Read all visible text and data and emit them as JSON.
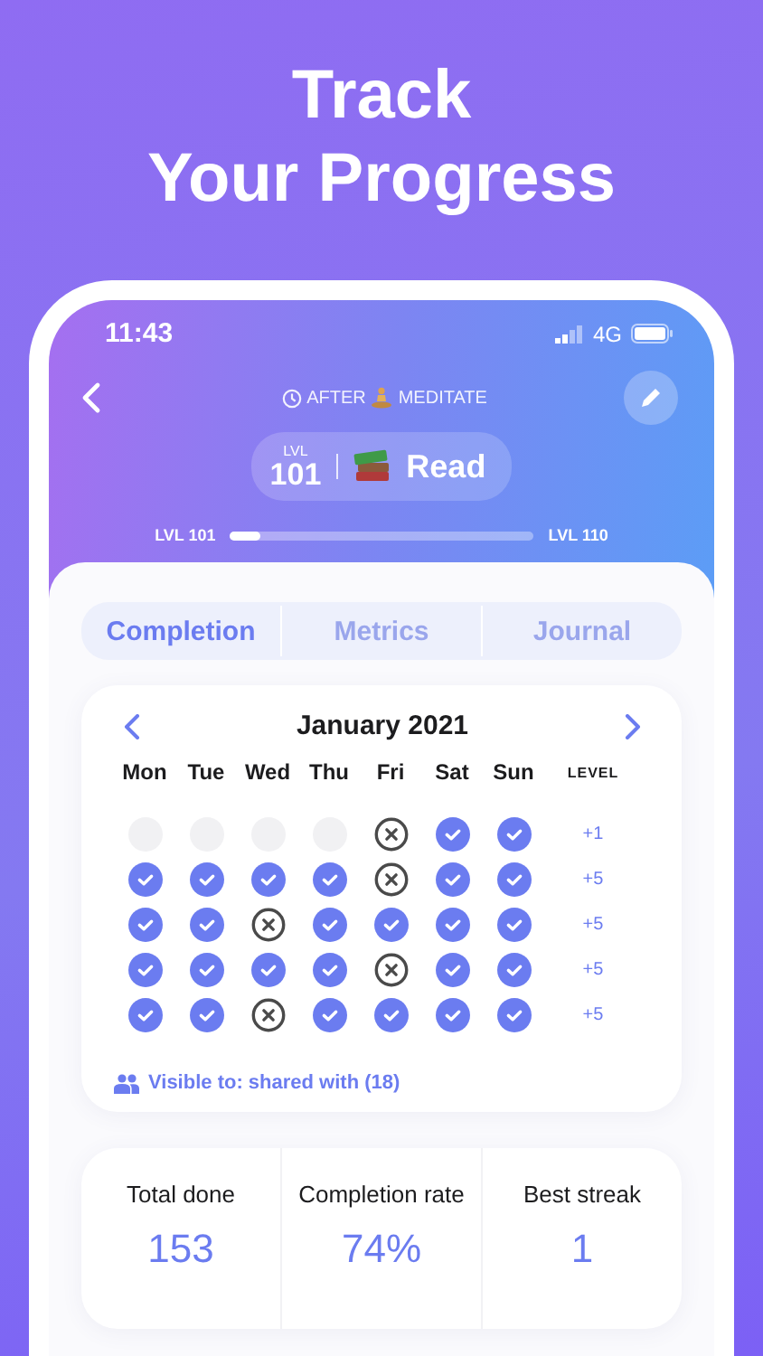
{
  "headline_lines": [
    "Track",
    "Your Progress"
  ],
  "status_bar": {
    "time": "11:43",
    "network": "4G"
  },
  "habit": {
    "trigger_prefix": "AFTER",
    "trigger": "MEDITATE",
    "level_label": "LVL",
    "level": "101",
    "name": "Read"
  },
  "progress": {
    "from": "LVL 101",
    "to": "LVL 110",
    "level": 0.1
  },
  "tabs": [
    {
      "label": "Completion",
      "selected": true
    },
    {
      "label": "Metrics",
      "selected": false
    },
    {
      "label": "Journal",
      "selected": false
    }
  ],
  "calendar": {
    "month": "January 2021",
    "weekdays": [
      "Mon",
      "Tue",
      "Wed",
      "Thu",
      "Fri",
      "Sat",
      "Sun"
    ],
    "level_heading": "LEVEL",
    "weeks": [
      {
        "days": [
          {
            "kind": "empty"
          },
          {
            "kind": "empty"
          },
          {
            "kind": "empty"
          },
          {
            "kind": "empty"
          },
          {
            "kind": "missed"
          },
          {
            "kind": "done"
          },
          {
            "kind": "done"
          }
        ],
        "level": "+1"
      },
      {
        "days": [
          {
            "kind": "done"
          },
          {
            "kind": "done"
          },
          {
            "kind": "done"
          },
          {
            "kind": "done"
          },
          {
            "kind": "missed"
          },
          {
            "kind": "done"
          },
          {
            "kind": "done"
          }
        ],
        "level": "+5"
      },
      {
        "days": [
          {
            "kind": "done"
          },
          {
            "kind": "done"
          },
          {
            "kind": "missed"
          },
          {
            "kind": "done"
          },
          {
            "kind": "done"
          },
          {
            "kind": "done"
          },
          {
            "kind": "done"
          }
        ],
        "level": "+5"
      },
      {
        "days": [
          {
            "kind": "done"
          },
          {
            "kind": "done"
          },
          {
            "kind": "done"
          },
          {
            "kind": "done"
          },
          {
            "kind": "missed"
          },
          {
            "kind": "done"
          },
          {
            "kind": "done"
          }
        ],
        "level": "+5"
      },
      {
        "days": [
          {
            "kind": "done"
          },
          {
            "kind": "done"
          },
          {
            "kind": "missed"
          },
          {
            "kind": "done"
          },
          {
            "kind": "done"
          },
          {
            "kind": "done"
          },
          {
            "kind": "done"
          }
        ],
        "level": "+5"
      }
    ],
    "visibility": "Visible to: shared with (18)"
  },
  "stats": [
    {
      "label": "Total done",
      "value": "153"
    },
    {
      "label": "Completion rate",
      "value": "74%"
    },
    {
      "label": "Best streak",
      "value": "1"
    }
  ]
}
